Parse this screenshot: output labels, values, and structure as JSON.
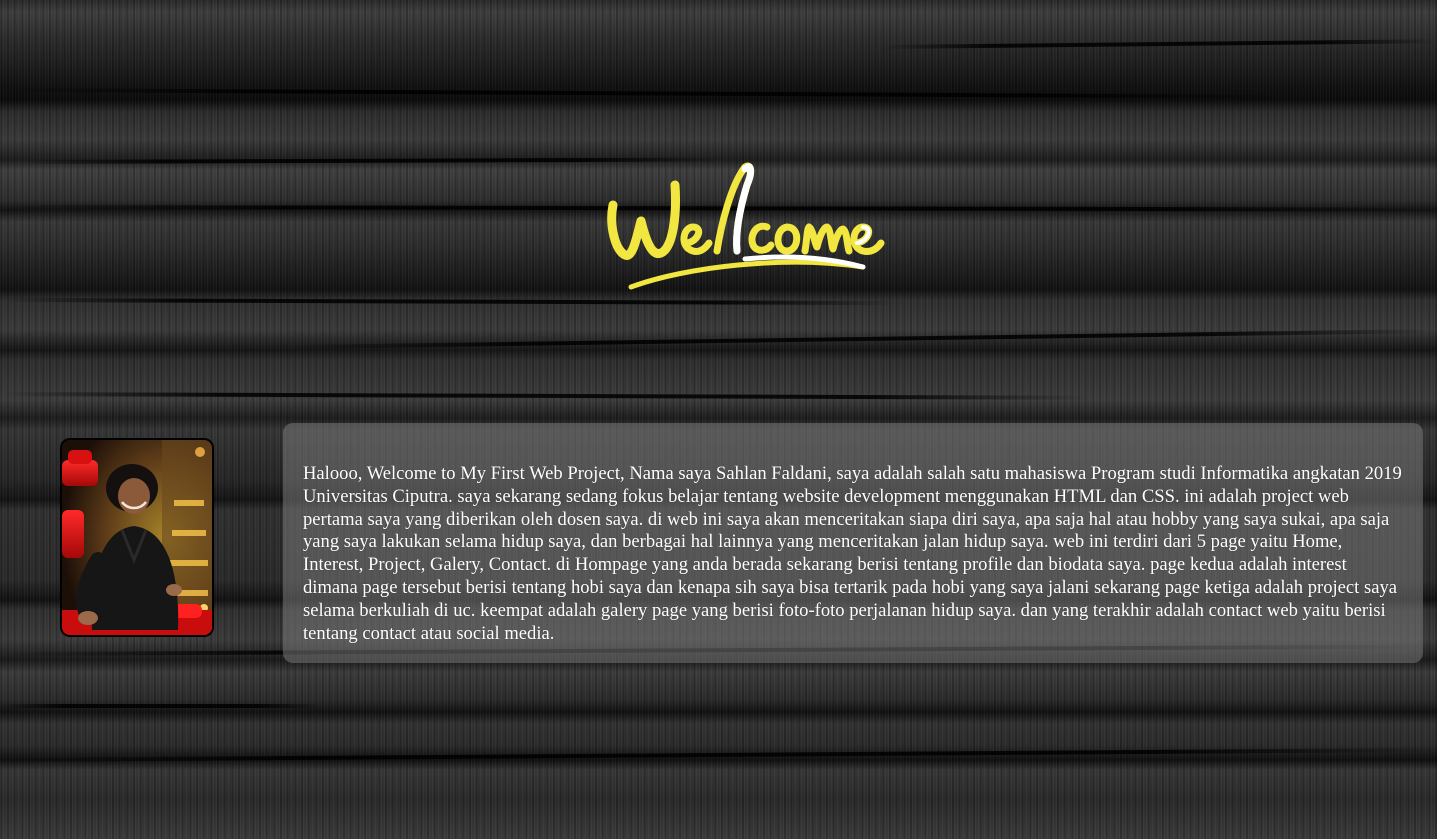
{
  "page": {
    "title_image": {
      "text": "Welcome",
      "colors": {
        "primary": "#f2e640",
        "accent": "#ffffff"
      }
    },
    "profile_photo": {
      "icon": "profile-photo"
    },
    "intro": {
      "text": "Halooo, Welcome to My First Web Project, Nama saya Sahlan Faldani, saya adalah salah satu mahasiswa Program studi Informatika angkatan 2019 Universitas Ciputra. saya sekarang sedang fokus belajar tentang website development menggunakan HTML dan CSS. ini adalah project web pertama saya yang diberikan oleh dosen saya. di web ini saya akan menceritakan siapa diri saya, apa saja hal atau hobby yang saya sukai, apa saja yang saya lakukan selama hidup saya, dan berbagai hal lainnya yang menceritakan jalan hidup saya. web ini terdiri dari 5 page yaitu Home, Interest, Project, Galery, Contact. di Hompage yang anda berada sekarang berisi tentang profile dan biodata saya. page kedua adalah interest dimana page tersebut berisi tentang hobi saya dan kenapa sih saya bisa tertarik pada hobi yang saya jalani sekarang page ketiga adalah project saya selama berkuliah di uc. keempat adalah galery page yang berisi foto-foto perjalanan hidup saya. dan yang terakhir adalah contact web yaitu berisi tentang contact atau social media."
    },
    "background": {
      "style": "dark brushed wood texture",
      "base_color": "#1a1a1a"
    }
  }
}
